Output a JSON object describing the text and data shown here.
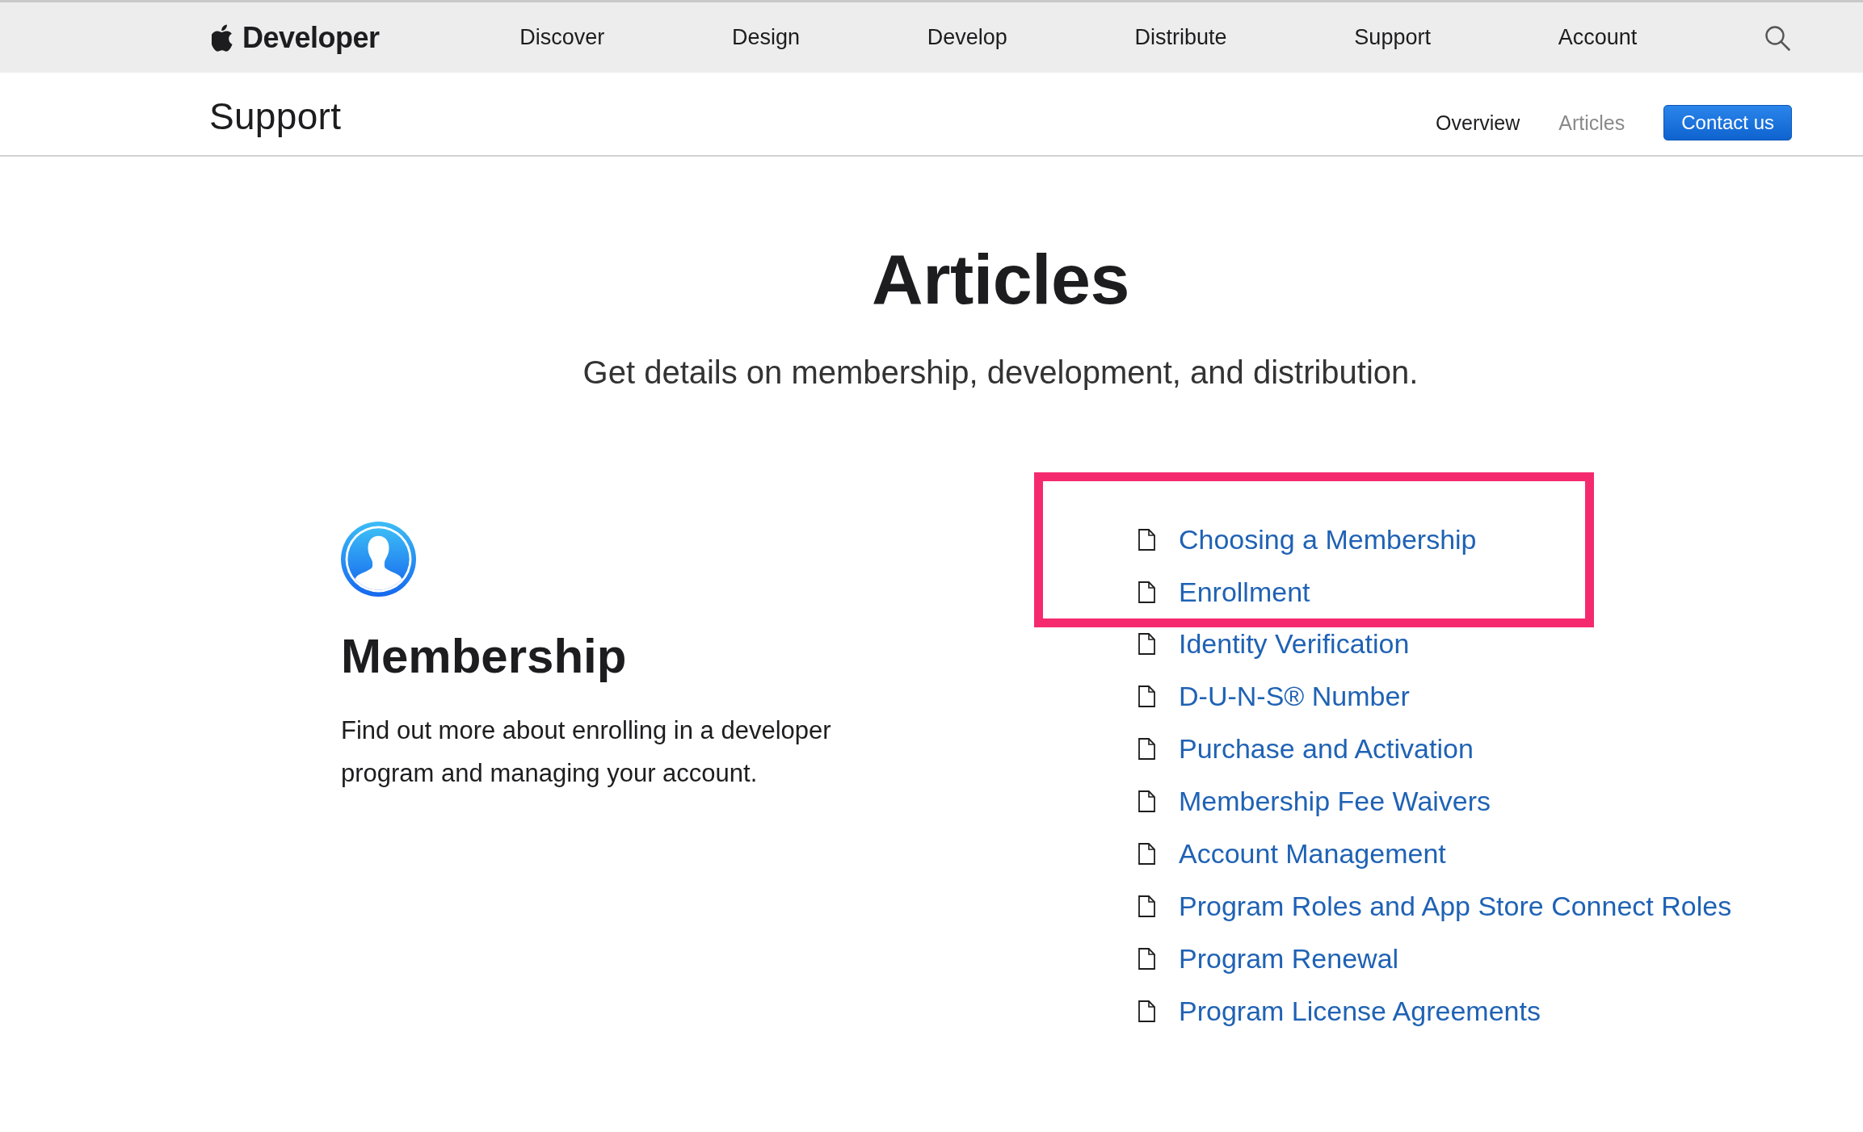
{
  "global_nav": {
    "logo_text": "Developer",
    "items": [
      {
        "label": "Discover"
      },
      {
        "label": "Design"
      },
      {
        "label": "Develop"
      },
      {
        "label": "Distribute"
      },
      {
        "label": "Support"
      },
      {
        "label": "Account"
      }
    ]
  },
  "local_nav": {
    "title": "Support",
    "items": [
      {
        "label": "Overview",
        "selected": false
      },
      {
        "label": "Articles",
        "selected": true
      }
    ],
    "button": "Contact us"
  },
  "page": {
    "title": "Articles",
    "subtitle": "Get details on membership, development, and distribution."
  },
  "section": {
    "title": "Membership",
    "description": "Find out more about enrolling in a developer program and managing your account.",
    "articles": [
      {
        "title": "Choosing a Membership",
        "highlighted": true
      },
      {
        "title": "Enrollment",
        "highlighted": true
      },
      {
        "title": "Identity Verification",
        "highlighted": false
      },
      {
        "title": "D-U-N-S® Number",
        "highlighted": false
      },
      {
        "title": "Purchase and Activation",
        "highlighted": false
      },
      {
        "title": "Membership Fee Waivers",
        "highlighted": false
      },
      {
        "title": "Account Management",
        "highlighted": false
      },
      {
        "title": "Program Roles and App Store Connect Roles",
        "highlighted": false
      },
      {
        "title": "Program Renewal",
        "highlighted": false
      },
      {
        "title": "Program License Agreements",
        "highlighted": false
      }
    ]
  }
}
